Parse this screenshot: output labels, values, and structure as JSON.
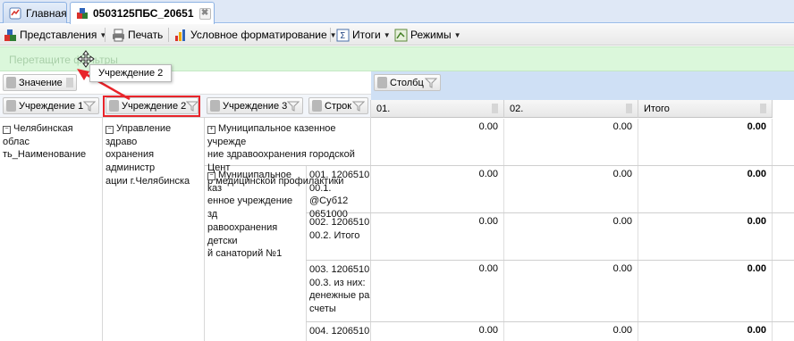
{
  "tabs": [
    {
      "label": "Главная",
      "icon": "home-icon",
      "active": false
    },
    {
      "label": "0503125ПБС_20651",
      "icon": "report-cubes-icon",
      "active": true,
      "close": "✖"
    }
  ],
  "toolbar": {
    "views_label": "Представления",
    "print_label": "Печать",
    "conditional_format_label": "Условное форматирование",
    "totals_label": "Итоги",
    "modes_label": "Режимы"
  },
  "dropzone": {
    "placeholder": "Перетащите фильтры"
  },
  "drag_tooltip": "Учреждение 2",
  "pivot": {
    "value_field": "Значение",
    "column_field": "Столбц",
    "row_fields": [
      "Учреждение 1",
      "Учреждение 2",
      "Учреждение 3",
      "Строк"
    ],
    "columns": [
      "01.",
      "02.",
      "Итого"
    ],
    "level1": {
      "toggle": "−",
      "text": [
        "Челябинская облас",
        "ть_Наименование"
      ]
    },
    "level2": {
      "toggle": "−",
      "text": [
        "Управление здраво",
        "охранения администр",
        "ации г.Челябинска"
      ]
    },
    "level3a": {
      "toggle": "+",
      "text": [
        "Муниципальное казенное учрежде",
        "ние здравоохранения городской Цент",
        "р медицинской профилактики"
      ]
    },
    "level3b": {
      "toggle": "−",
      "text": [
        "Муниципальное каз",
        "енное учреждение зд",
        "равоохранения детски",
        "й санаторий №1"
      ]
    },
    "rows": [
      {
        "label": [],
        "values": [
          "0.00",
          "0.00",
          "0.00"
        ]
      },
      {
        "label": [
          "001. 1206510",
          "00.1. @Суб12",
          "0651000"
        ],
        "values": [
          "0.00",
          "0.00",
          "0.00"
        ]
      },
      {
        "label": [
          "002. 1206510",
          "00.2. Итого"
        ],
        "values": [
          "0.00",
          "0.00",
          "0.00"
        ]
      },
      {
        "label": [
          "003. 1206510",
          "00.3. из них:",
          "денежные ра",
          "счеты"
        ],
        "values": [
          "0.00",
          "0.00",
          "0.00"
        ]
      },
      {
        "label": [
          "004. 1206510"
        ],
        "values": [
          "0.00",
          "0.00",
          "0.00"
        ]
      }
    ]
  },
  "colors": {
    "highlight": "#e8242a",
    "dropzone": "#dbf7db",
    "column_zone": "#cfe0f5"
  }
}
